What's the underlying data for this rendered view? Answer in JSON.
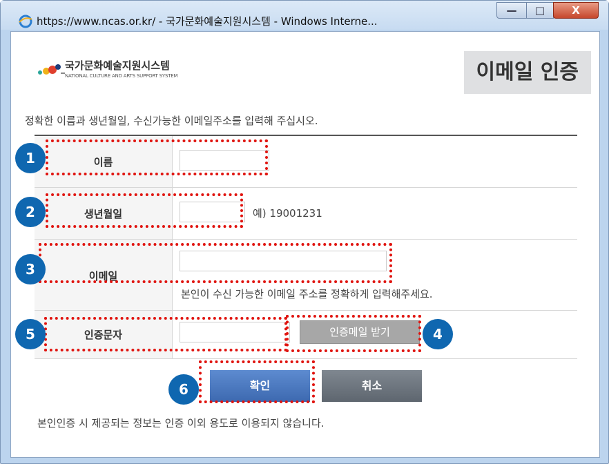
{
  "window": {
    "title": "https://www.ncas.or.kr/ - 국가문화예술지원시스템 - Windows Interne...",
    "minimize_glyph": "—",
    "maximize_glyph": "□",
    "close_glyph": "X"
  },
  "header": {
    "logo_kr": "국가문화예술지원시스템",
    "logo_en": "NATIONAL CULTURE AND ARTS SUPPORT SYSTEM",
    "title": "이메일 인증"
  },
  "guide_text": "정확한 이름과 생년월일, 수신가능한 이메일주소를 입력해 주십시오.",
  "form": {
    "name_label": "이름",
    "birth_label": "생년월일",
    "birth_hint": "예) 19001231",
    "email_label": "이메일",
    "email_hint": "본인이 수신 가능한 이메일 주소를 정확하게 입력해주세요.",
    "code_label": "인증문자",
    "send_button": "인증메일 받기"
  },
  "buttons": {
    "ok": "확인",
    "cancel": "취소"
  },
  "notice": "본인인증 시 제공되는 정보는 인증 이외 용도로 이용되지 않습니다.",
  "badges": [
    "1",
    "2",
    "3",
    "4",
    "5",
    "6"
  ],
  "colors": {
    "badge": "#0f67b0",
    "dashed_box": "#e0140f",
    "ok_button": "#3d69b0",
    "cancel_button": "#5e666f"
  }
}
